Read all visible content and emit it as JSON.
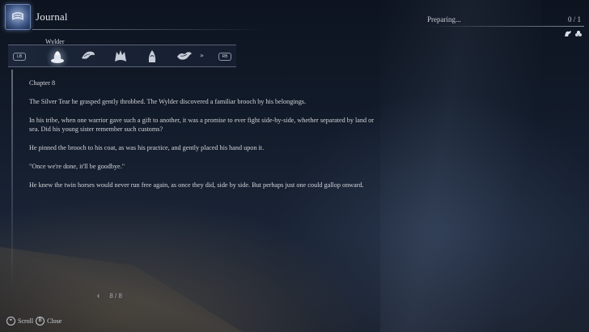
{
  "header": {
    "title": "Journal",
    "icon": "journal-scroll-icon"
  },
  "progress": {
    "label": "Preparing...",
    "count": "0 / 1"
  },
  "status_icons": [
    "horse-icon",
    "flower-icon"
  ],
  "tabs": {
    "left_shoulder": "LB",
    "right_shoulder": "RB",
    "more_indicator": "»",
    "active_label": "Wylder",
    "items": [
      {
        "icon": "wylder-icon",
        "active": true
      },
      {
        "icon": "bird-icon",
        "active": false
      },
      {
        "icon": "wolf-icon",
        "active": false
      },
      {
        "icon": "hooded-figure-icon",
        "active": false
      },
      {
        "icon": "dragon-icon",
        "active": false
      }
    ]
  },
  "journal": {
    "chapter": "Chapter 8",
    "paragraphs": [
      "The Silver Tear he grasped gently throbbed. The Wylder discovered a familiar brooch by his belongings.",
      "In his tribe, when one warrior gave such a gift to another, it was a promise to ever fight side-by-side, whether separated by land or sea. Did his young sister remember such customs?",
      "He pinned the brooch to his coat, as was his practice, and gently placed his hand upon it.",
      "\"Once we're done, it'll be goodbye.\"",
      "He knew the twin horses would never run free again, as once they did, side by side. But perhaps just one could gallop onward."
    ]
  },
  "pager": {
    "prev_arrow": "‹",
    "text": "8 / 8"
  },
  "footer": {
    "scroll_button": "⌖",
    "scroll_label": "Scroll",
    "close_button": "B",
    "close_label": "Close"
  }
}
